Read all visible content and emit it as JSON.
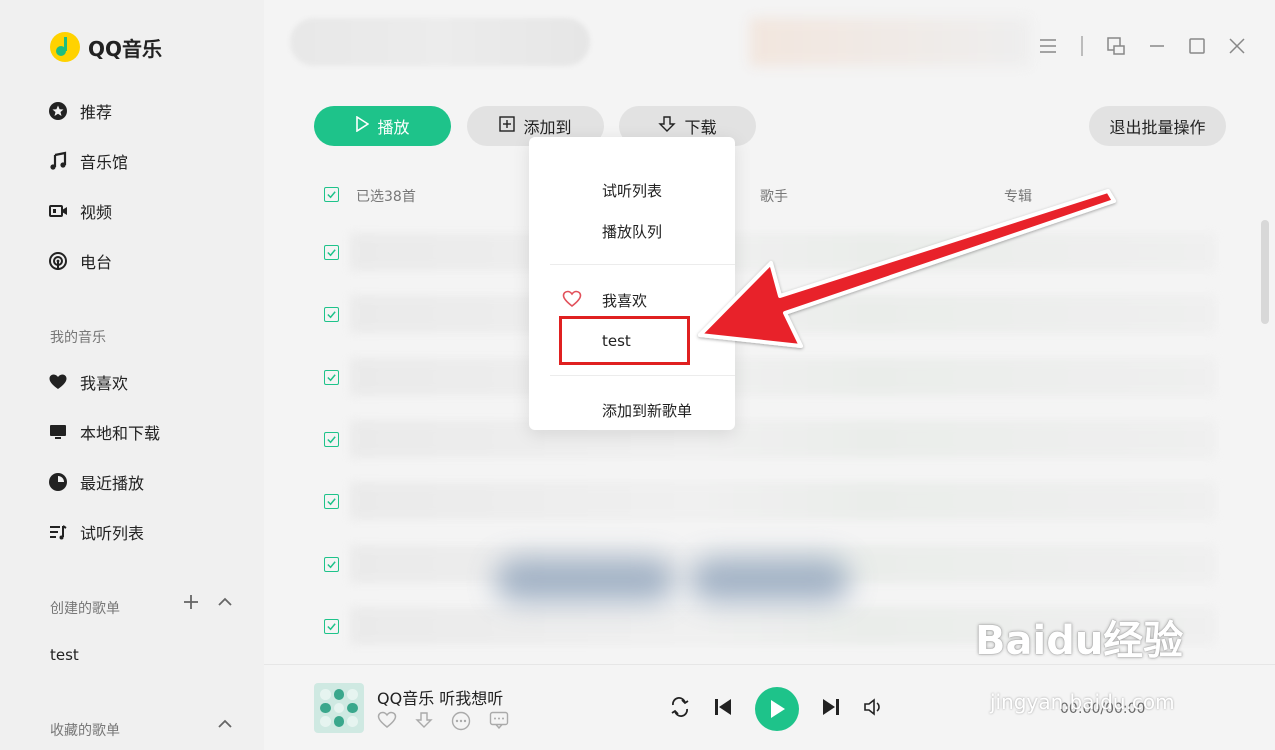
{
  "app": {
    "name": "QQ音乐"
  },
  "sidebar": {
    "nav": [
      {
        "label": "推荐",
        "icon": "star-circle-icon"
      },
      {
        "label": "音乐馆",
        "icon": "music-note-icon"
      },
      {
        "label": "视频",
        "icon": "video-icon"
      },
      {
        "label": "电台",
        "icon": "radio-icon"
      }
    ],
    "my_music_title": "我的音乐",
    "my_music": [
      {
        "label": "我喜欢",
        "icon": "heart-icon"
      },
      {
        "label": "本地和下载",
        "icon": "monitor-icon"
      },
      {
        "label": "最近播放",
        "icon": "clock-icon"
      },
      {
        "label": "试听列表",
        "icon": "playlist-icon"
      }
    ],
    "created_title": "创建的歌单",
    "created_playlists": [
      "test"
    ],
    "collected_title": "收藏的歌单"
  },
  "toolbar": {
    "play_label": "播放",
    "add_to_label": "添加到",
    "download_label": "下载",
    "exit_batch_label": "退出批量操作"
  },
  "table": {
    "selected_label": "已选38首",
    "col_singer": "歌手",
    "col_album": "专辑"
  },
  "dropdown": {
    "items": [
      "试听列表",
      "播放队列",
      "我喜欢",
      "test",
      "添加到新歌单"
    ]
  },
  "player": {
    "title": "QQ音乐 听我想听",
    "time": "00:00/00:00"
  },
  "watermark": {
    "main": "Baidu经验",
    "sub": "jingyan.baidu.com"
  },
  "colors": {
    "accent": "#1ec38a",
    "highlight": "#e02020"
  }
}
